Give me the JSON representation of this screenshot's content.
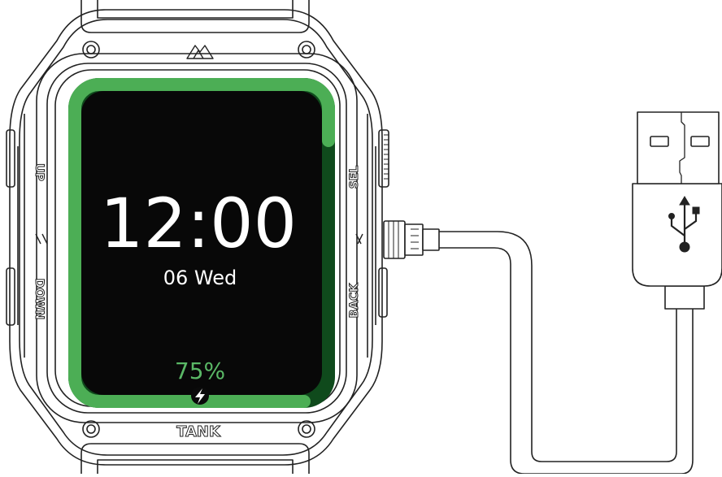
{
  "watch": {
    "brand_text": "TANK",
    "time": "12:00",
    "date": "06 Wed",
    "battery": "75%",
    "battery_level": 0.75,
    "labels": {
      "up": "UP",
      "down": "DOWN",
      "select": "SEL",
      "back": "BACK"
    },
    "colors": {
      "screen": "#080808",
      "ring": "#4cae55",
      "ring_track": "#0f4a1c",
      "battery_text": "#5ab866"
    }
  },
  "cable": {
    "icon": "usb-icon"
  }
}
